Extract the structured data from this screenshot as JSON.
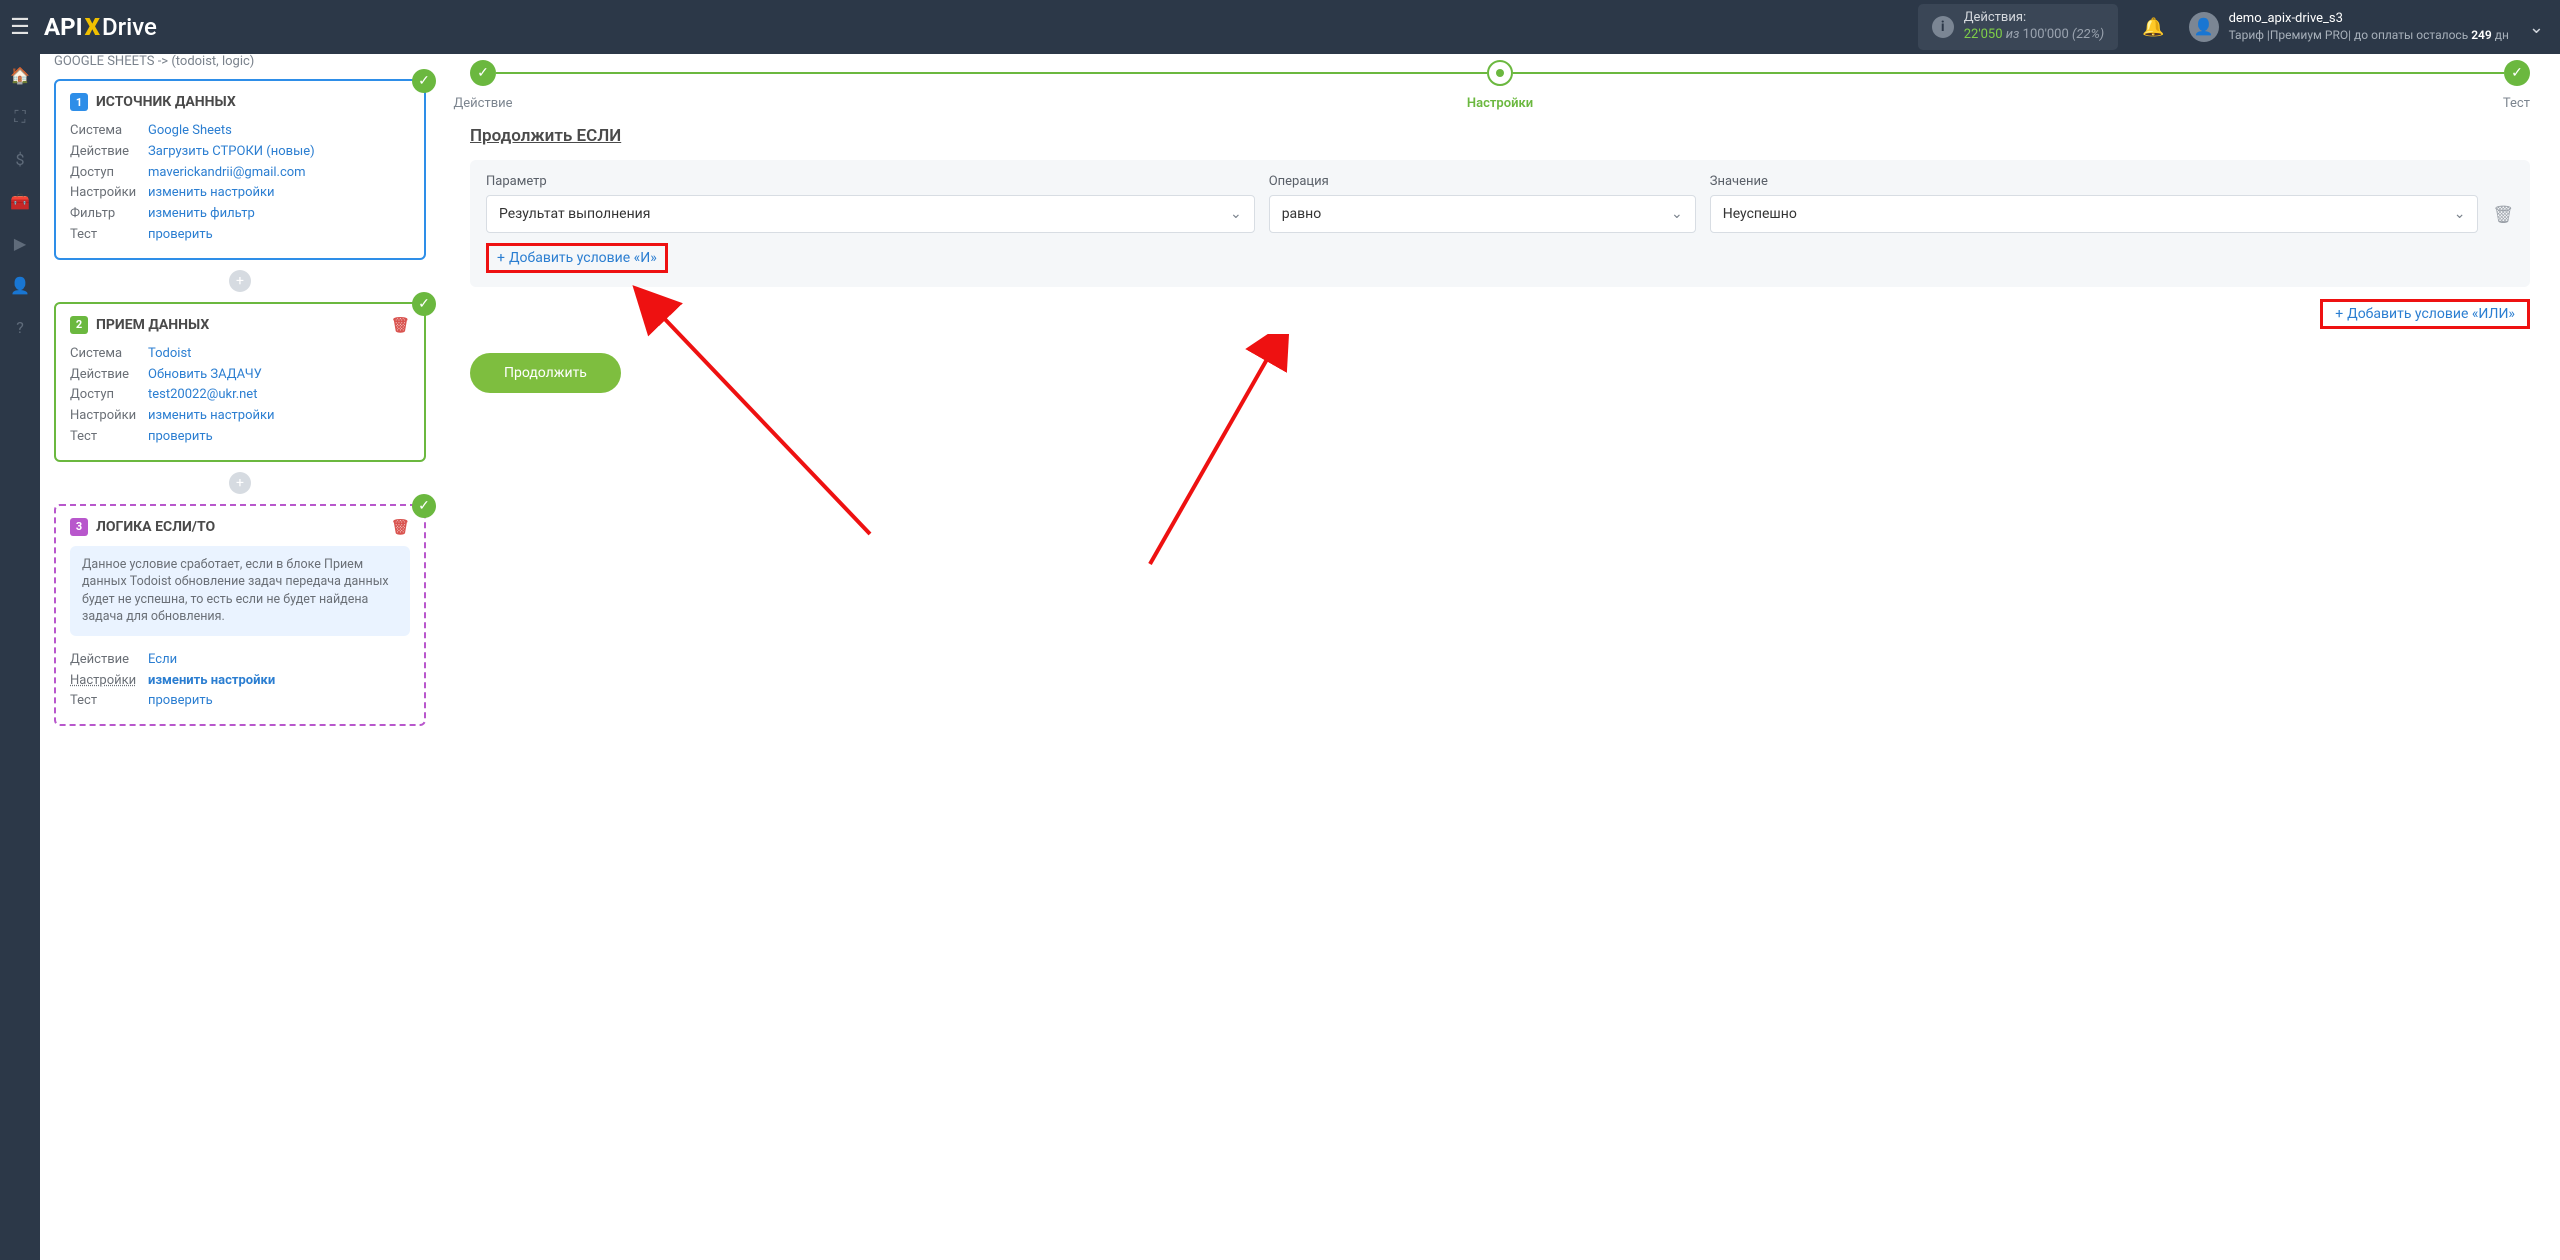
{
  "brand": {
    "p1": "API",
    "p2": "X",
    "p3": "Drive"
  },
  "header": {
    "actions_label": "Действия:",
    "actions_used": "22'050",
    "actions_sep": "из",
    "actions_total": "100'000",
    "actions_pct": "(22%)",
    "user_name": "demo_apix-drive_s3",
    "tariff_prefix": "Тариф |Премиум PRO| до оплаты осталось ",
    "tariff_days": "249",
    "tariff_suffix": " дн"
  },
  "breadcrumb": "GOOGLE SHEETS -> (todoist, logic)",
  "card1": {
    "title": "ИСТОЧНИК ДАННЫХ",
    "rows": {
      "r0": {
        "label": "Система",
        "val": "Google Sheets"
      },
      "r1": {
        "label": "Действие",
        "val": "Загрузить СТРОКИ (новые)"
      },
      "r2": {
        "label": "Доступ",
        "val": "maverickandrii@gmail.com"
      },
      "r3": {
        "label": "Настройки",
        "val": "изменить настройки"
      },
      "r4": {
        "label": "Фильтр",
        "val": "изменить фильтр"
      },
      "r5": {
        "label": "Тест",
        "val": "проверить"
      }
    }
  },
  "card2": {
    "title": "ПРИЕМ ДАННЫХ",
    "rows": {
      "r0": {
        "label": "Система",
        "val": "Todoist"
      },
      "r1": {
        "label": "Действие",
        "val": "Обновить ЗАДАЧУ"
      },
      "r2": {
        "label": "Доступ",
        "val": "test20022@ukr.net"
      },
      "r3": {
        "label": "Настройки",
        "val": "изменить настройки"
      },
      "r4": {
        "label": "Тест",
        "val": "проверить"
      }
    }
  },
  "card3": {
    "title": "ЛОГИКА ЕСЛИ/ТО",
    "note": "Данное условие сработает, если в блоке Прием данных Todoist обновление задач передача данных будет не успешна, то есть если не будет найдена задача для обновления.",
    "rows": {
      "r0": {
        "label": "Действие",
        "val": "Если"
      },
      "r1": {
        "label": "Настройки",
        "val": "изменить настройки"
      },
      "r2": {
        "label": "Тест",
        "val": "проверить"
      }
    }
  },
  "stepper": {
    "s1": "Действие",
    "s2": "Настройки",
    "s3": "Тест"
  },
  "section_title": "Продолжить ЕСЛИ",
  "cond": {
    "param_label": "Параметр",
    "op_label": "Операция",
    "val_label": "Значение",
    "param_value": "Результат выполнения",
    "op_value": "равно",
    "val_value": "Неуспешно",
    "add_and": "Добавить условие «И»",
    "add_or": "Добавить условие «ИЛИ»"
  },
  "btn_continue": "Продолжить"
}
